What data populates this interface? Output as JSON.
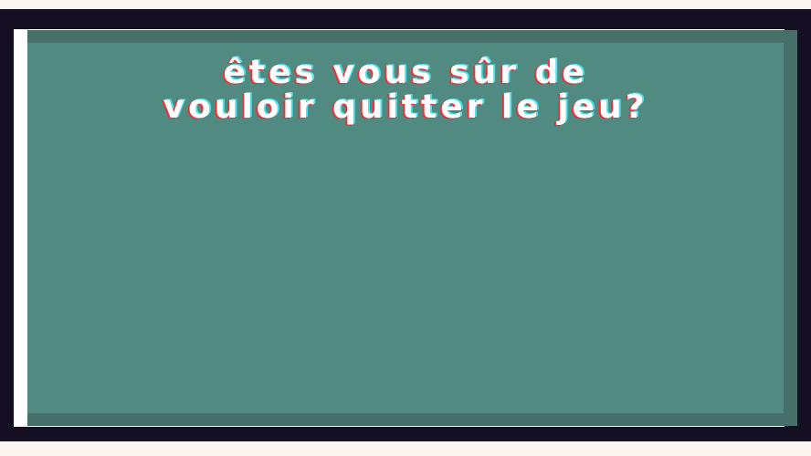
{
  "dialog": {
    "line1": "Êtes vous sûr de",
    "line2": "vouloir quitter le jeu?"
  },
  "colors": {
    "page_background": "#faf6ee",
    "frame_dark": "#140f22",
    "frame_white": "#ffffff",
    "panel": "#508a80",
    "panel_shadow": "#456f68",
    "text": "#ffffff",
    "text_shadow_red": "#e8333a",
    "text_shadow_cyan": "#4ee0e8"
  }
}
